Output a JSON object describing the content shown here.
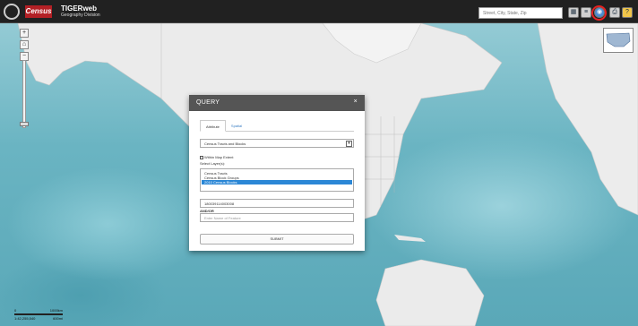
{
  "header": {
    "logo_text": "Census",
    "app_title": "TIGERweb",
    "app_subtitle": "Geography Division",
    "search_placeholder": "Street, City, State, Zip",
    "toolbar_icons": [
      "layers-icon",
      "legend-icon",
      "globe-icon",
      "query-icon",
      "print-icon",
      "help-icon"
    ]
  },
  "nav": {
    "zoom_in": "+",
    "zoom_out": "−",
    "home": "⌂"
  },
  "scale": {
    "left_label": "0",
    "right_label": "1000km",
    "bottom_left": "1:42,255,540",
    "bottom_right": "600mi"
  },
  "query_dialog": {
    "title": "QUERY",
    "close": "×",
    "tabs": [
      "Attribute",
      "Spatial"
    ],
    "active_tab": "Attribute",
    "layer_select_value": "Census Tracts and Blocks",
    "checkbox_label": "Within Map Extent",
    "select_layers_label": "Select Layer(s):",
    "layers": [
      "Census Tracts",
      "Census Block Groups",
      "2010 Census Blocks"
    ],
    "selected_layer": "2010 Census Blocks",
    "query_value": "180039114003008",
    "andor_label": "AND/OR",
    "attr_placeholder": "Enter Name of Feature",
    "submit_label": "SUBMIT"
  },
  "colors": {
    "header_bg": "#212121",
    "dialog_header_bg": "#555555",
    "highlight_ring": "#e52222",
    "selected_layer": "#2b87d6",
    "census_red": "#b32025"
  }
}
